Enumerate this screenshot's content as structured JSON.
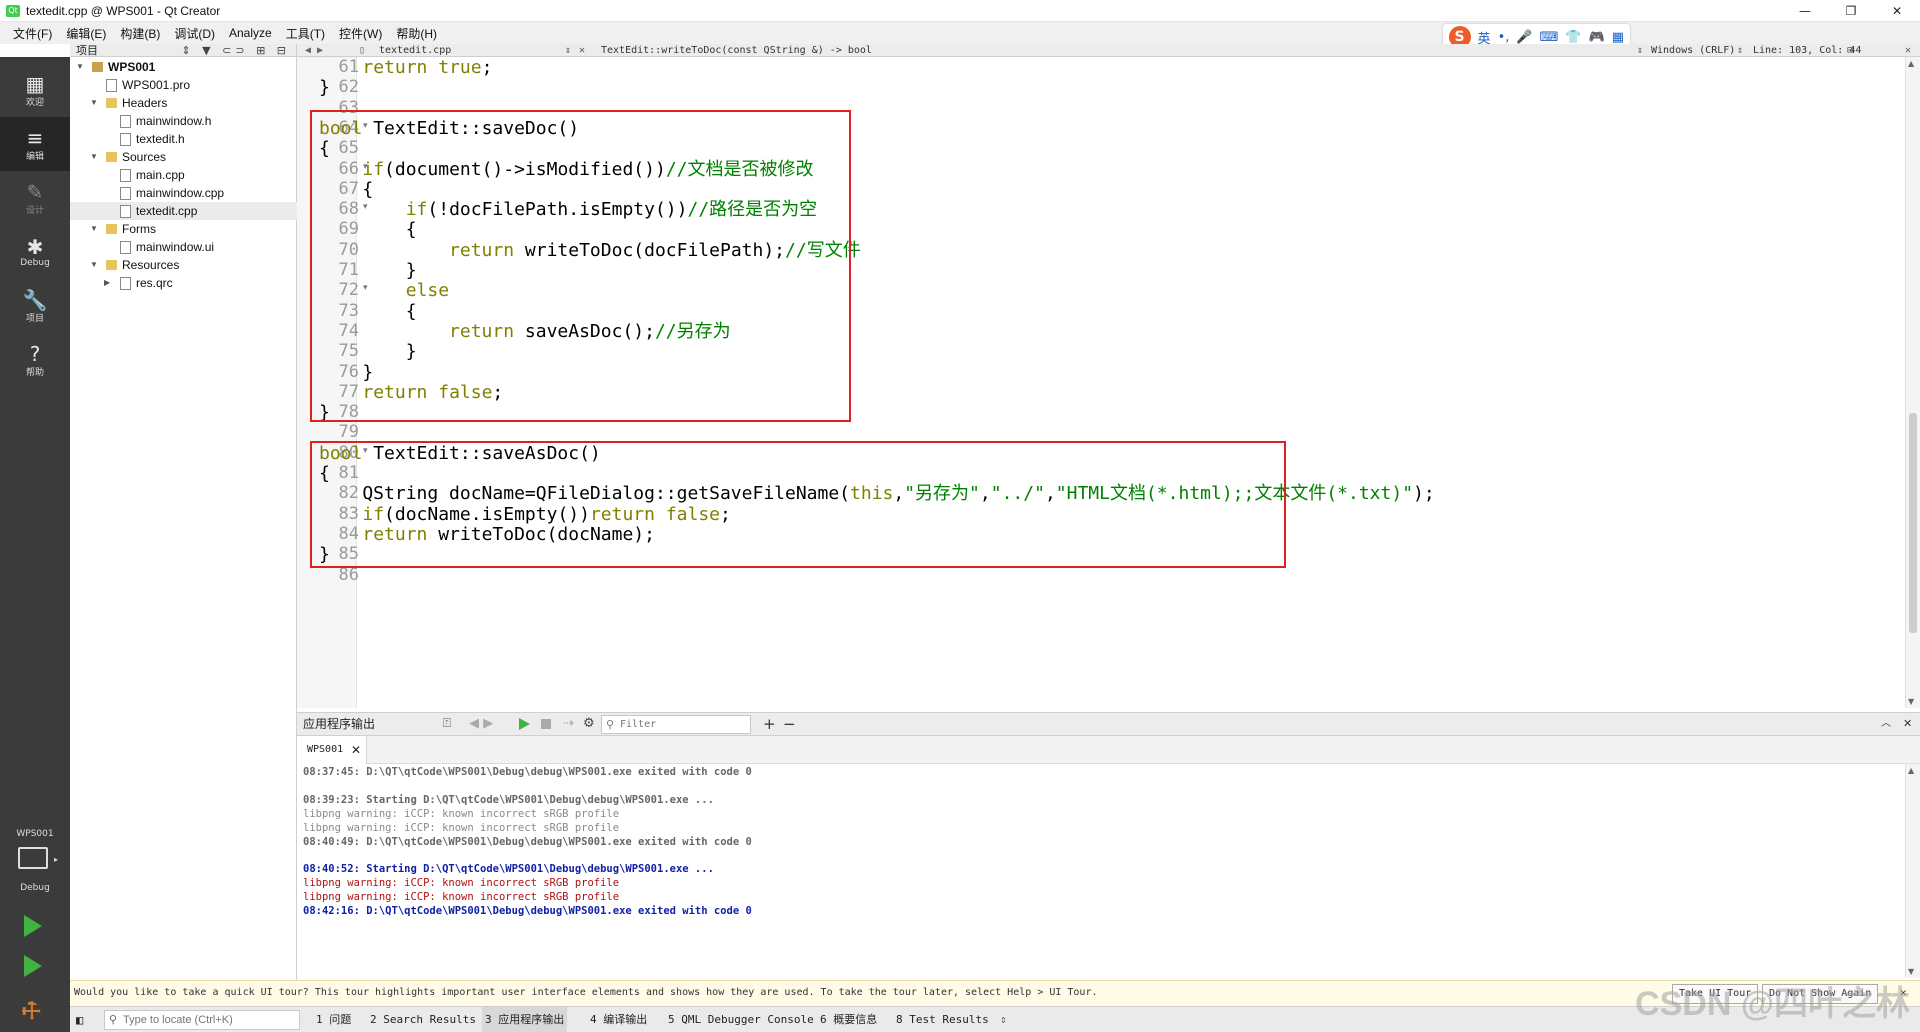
{
  "window": {
    "title": "textedit.cpp @ WPS001 - Qt Creator",
    "minimize": "—",
    "maximize": "❐",
    "close": "✕"
  },
  "menu": [
    "文件(F)",
    "编辑(E)",
    "构建(B)",
    "调试(D)",
    "Analyze",
    "工具(T)",
    "控件(W)",
    "帮助(H)"
  ],
  "ime": {
    "logo": "S",
    "lang": "英",
    "punct": "•,",
    "mic": "🎤",
    "keyboard": "⌨",
    "shirt": "👕",
    "game": "🎮",
    "grid": "▦"
  },
  "modes": [
    {
      "label": "欢迎",
      "icon": "▦"
    },
    {
      "label": "编辑",
      "icon": "≡"
    },
    {
      "label": "设计",
      "icon": "✎"
    },
    {
      "label": "Debug",
      "icon": "✱"
    },
    {
      "label": "项目",
      "icon": "🔧"
    },
    {
      "label": "帮助",
      "icon": "?"
    }
  ],
  "kit": {
    "project": "WPS001",
    "config": "Debug"
  },
  "project_pane": {
    "title": "项目"
  },
  "tree": [
    {
      "label": "WPS001",
      "depth": 0,
      "type": "proj",
      "arrow": "▼",
      "bold": true
    },
    {
      "label": "WPS001.pro",
      "depth": 1,
      "type": "file",
      "arrow": ""
    },
    {
      "label": "Headers",
      "depth": 1,
      "type": "folder",
      "arrow": "▼"
    },
    {
      "label": "mainwindow.h",
      "depth": 2,
      "type": "file",
      "arrow": ""
    },
    {
      "label": "textedit.h",
      "depth": 2,
      "type": "file",
      "arrow": ""
    },
    {
      "label": "Sources",
      "depth": 1,
      "type": "folder",
      "arrow": "▼"
    },
    {
      "label": "main.cpp",
      "depth": 2,
      "type": "file",
      "arrow": ""
    },
    {
      "label": "mainwindow.cpp",
      "depth": 2,
      "type": "file",
      "arrow": ""
    },
    {
      "label": "textedit.cpp",
      "depth": 2,
      "type": "file",
      "arrow": "",
      "selected": true
    },
    {
      "label": "Forms",
      "depth": 1,
      "type": "folder",
      "arrow": "▼"
    },
    {
      "label": "mainwindow.ui",
      "depth": 2,
      "type": "file",
      "arrow": ""
    },
    {
      "label": "Resources",
      "depth": 1,
      "type": "folder",
      "arrow": "▼"
    },
    {
      "label": "res.qrc",
      "depth": 2,
      "type": "file",
      "arrow": "▶"
    }
  ],
  "editor": {
    "file": "textedit.cpp",
    "symbol": "TextEdit::writeToDoc(const QString &) -> bool",
    "line_ending": "Windows (CRLF)",
    "position": "Line: 103, Col: 44"
  },
  "code_lines": [
    {
      "n": "61",
      "html": "    <span class=\"kw\">return</span> <span class=\"kw\">true</span>;"
    },
    {
      "n": "62",
      "html": "}"
    },
    {
      "n": "63",
      "html": ""
    },
    {
      "n": "64",
      "html": "<span class=\"kw\">bool</span> TextEdit::saveDoc()",
      "fold": true
    },
    {
      "n": "65",
      "html": "{"
    },
    {
      "n": "66",
      "html": "    <span class=\"kw\">if</span>(document()-&gt;isModified())<span class=\"cm\">//文档是否被修改</span>",
      "fold": true
    },
    {
      "n": "67",
      "html": "    {"
    },
    {
      "n": "68",
      "html": "        <span class=\"kw\">if</span>(!docFilePath.isEmpty())<span class=\"cm\">//路径是否为空</span>",
      "fold": true
    },
    {
      "n": "69",
      "html": "        {"
    },
    {
      "n": "70",
      "html": "            <span class=\"kw\">return</span> writeToDoc(docFilePath);<span class=\"cm\">//写文件</span>"
    },
    {
      "n": "71",
      "html": "        }"
    },
    {
      "n": "72",
      "html": "        <span class=\"kw\">else</span>",
      "fold": true
    },
    {
      "n": "73",
      "html": "        {"
    },
    {
      "n": "74",
      "html": "            <span class=\"kw\">return</span> saveAsDoc();<span class=\"cm\">//另存为</span>"
    },
    {
      "n": "75",
      "html": "        }"
    },
    {
      "n": "76",
      "html": "    }"
    },
    {
      "n": "77",
      "html": "    <span class=\"kw\">return</span> <span class=\"kw\">false</span>;"
    },
    {
      "n": "78",
      "html": "}"
    },
    {
      "n": "79",
      "html": ""
    },
    {
      "n": "80",
      "html": "<span class=\"kw\">bool</span> TextEdit::saveAsDoc()",
      "fold": true
    },
    {
      "n": "81",
      "html": "{"
    },
    {
      "n": "82",
      "html": "    QString docName=QFileDialog::getSaveFileName(<span class=\"kw\">this</span>,<span class=\"str\">\"另存为\"</span>,<span class=\"str\">\"../\"</span>,<span class=\"str\">\"HTML文档(*.html);;文本文件(*.txt)\"</span>);"
    },
    {
      "n": "83",
      "html": "    <span class=\"kw\">if</span>(docName.isEmpty())<span class=\"kw\">return</span> <span class=\"kw\">false</span>;"
    },
    {
      "n": "84",
      "html": "    <span class=\"kw\">return</span> writeToDoc(docName);"
    },
    {
      "n": "85",
      "html": "}"
    },
    {
      "n": "86",
      "html": ""
    }
  ],
  "output": {
    "title": "应用程序输出",
    "filter_placeholder": "Filter",
    "tab": "WPS001",
    "lines": [
      {
        "text": "08:37:45: D:\\QT\\qtCode\\WPS001\\Debug\\debug\\WPS001.exe exited with code 0",
        "style": "g"
      },
      {
        "text": "",
        "style": "g"
      },
      {
        "text": "08:39:23: Starting D:\\QT\\qtCode\\WPS001\\Debug\\debug\\WPS001.exe ...",
        "style": "g"
      },
      {
        "text": "libpng warning: iCCP: known incorrect sRGB profile",
        "style": "gl"
      },
      {
        "text": "libpng warning: iCCP: known incorrect sRGB profile",
        "style": "gl"
      },
      {
        "text": "08:40:49: D:\\QT\\qtCode\\WPS001\\Debug\\debug\\WPS001.exe exited with code 0",
        "style": "g"
      },
      {
        "text": "",
        "style": "g"
      },
      {
        "text": "08:40:52: Starting D:\\QT\\qtCode\\WPS001\\Debug\\debug\\WPS001.exe ...",
        "style": "b"
      },
      {
        "text": "libpng warning: iCCP: known incorrect sRGB profile",
        "style": "r"
      },
      {
        "text": "libpng warning: iCCP: known incorrect sRGB profile",
        "style": "r"
      },
      {
        "text": "08:42:16: D:\\QT\\qtCode\\WPS001\\Debug\\debug\\WPS001.exe exited with code 0",
        "style": "b"
      }
    ]
  },
  "tour": {
    "message": "Would you like to take a quick UI tour? This tour highlights important user interface elements and shows how they are used. To take the tour later, select Help > UI Tour.",
    "take": "Take UI Tour",
    "dismiss": "Do Not Show Again"
  },
  "status": {
    "locate_placeholder": "Type to locate (Ctrl+K)",
    "panes": [
      "1 问题",
      "2 Search Results",
      "3 应用程序输出",
      "4 编译输出",
      "5 QML Debugger Console",
      "6 概要信息",
      "8 Test Results"
    ]
  },
  "watermark": "CSDN @四叶之林"
}
